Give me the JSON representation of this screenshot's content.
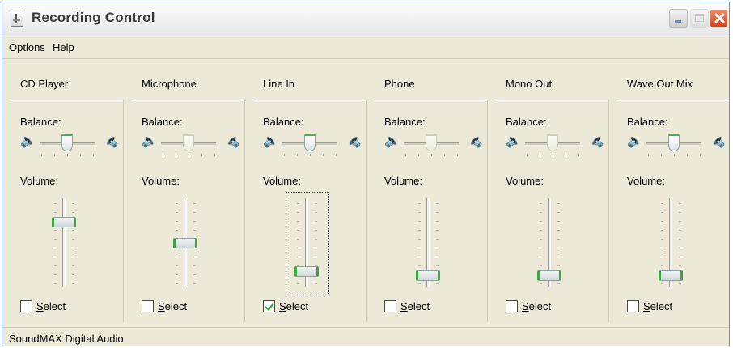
{
  "window": {
    "title": "Recording Control"
  },
  "menu": [
    "Options",
    "Help"
  ],
  "labels": {
    "balance": "Balance:",
    "volume": "Volume:"
  },
  "channels": [
    {
      "name": "CD Player",
      "balance": 0.5,
      "balance_active": true,
      "volume": 0.74,
      "selected": false,
      "focused": false
    },
    {
      "name": "Microphone",
      "balance": 0.5,
      "balance_active": false,
      "volume": 0.5,
      "selected": false,
      "focused": false
    },
    {
      "name": "Line In",
      "balance": 0.5,
      "balance_active": true,
      "volume": 0.18,
      "selected": true,
      "focused": true
    },
    {
      "name": "Phone",
      "balance": 0.5,
      "balance_active": false,
      "volume": 0.14,
      "selected": false,
      "focused": false
    },
    {
      "name": "Mono Out",
      "balance": 0.5,
      "balance_active": false,
      "volume": 0.14,
      "selected": false,
      "focused": false
    },
    {
      "name": "Wave Out Mix",
      "balance": 0.5,
      "balance_active": true,
      "volume": 0.14,
      "selected": false,
      "focused": false
    }
  ],
  "select": {
    "underline": "S",
    "rest": "elect"
  },
  "status": "SoundMAX Digital Audio",
  "icons": {
    "app": "mixer-icon",
    "speaker": "speaker-icon",
    "minimize": "minimize-icon",
    "maximize": "maximize-icon",
    "close": "close-icon"
  },
  "colors": {
    "accent": "#3aa840",
    "close": "#d2451f",
    "face": "#ECE9D8"
  }
}
